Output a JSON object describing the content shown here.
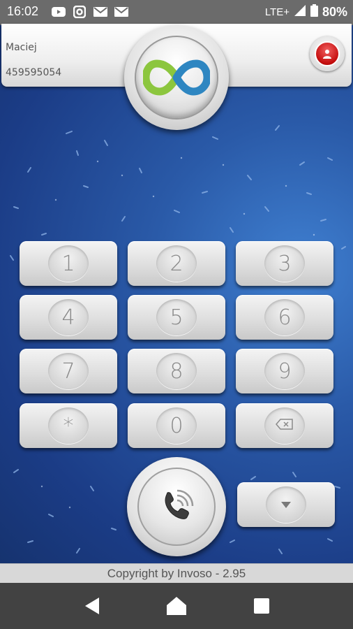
{
  "status_bar": {
    "time": "16:02",
    "notifications": [
      "youtube-icon",
      "instagram-icon",
      "mail-icon",
      "mail-icon"
    ],
    "network": "LTE+",
    "battery": "80%"
  },
  "header": {
    "user_name": "Maciej",
    "user_number": "459595054",
    "logo": "infinity-logo-icon",
    "profile_button_icon": "user-icon"
  },
  "keypad": {
    "keys": [
      {
        "label": "1"
      },
      {
        "label": "2"
      },
      {
        "label": "3"
      },
      {
        "label": "4"
      },
      {
        "label": "5"
      },
      {
        "label": "6"
      },
      {
        "label": "7"
      },
      {
        "label": "8"
      },
      {
        "label": "9"
      },
      {
        "label": "*"
      },
      {
        "label": "0"
      },
      {
        "icon": "backspace-icon"
      }
    ],
    "call_icon": "phone-call-icon",
    "more_icon": "chevron-down-icon"
  },
  "footer": {
    "copyright": "Copyright by Invoso - 2.95"
  },
  "nav": [
    "back-icon",
    "home-icon",
    "recents-icon"
  ],
  "colors": {
    "background": "#1c3f86",
    "profile_red": "#c40d0d",
    "logo_green": "#8cc63e",
    "logo_blue": "#2e86c1"
  }
}
